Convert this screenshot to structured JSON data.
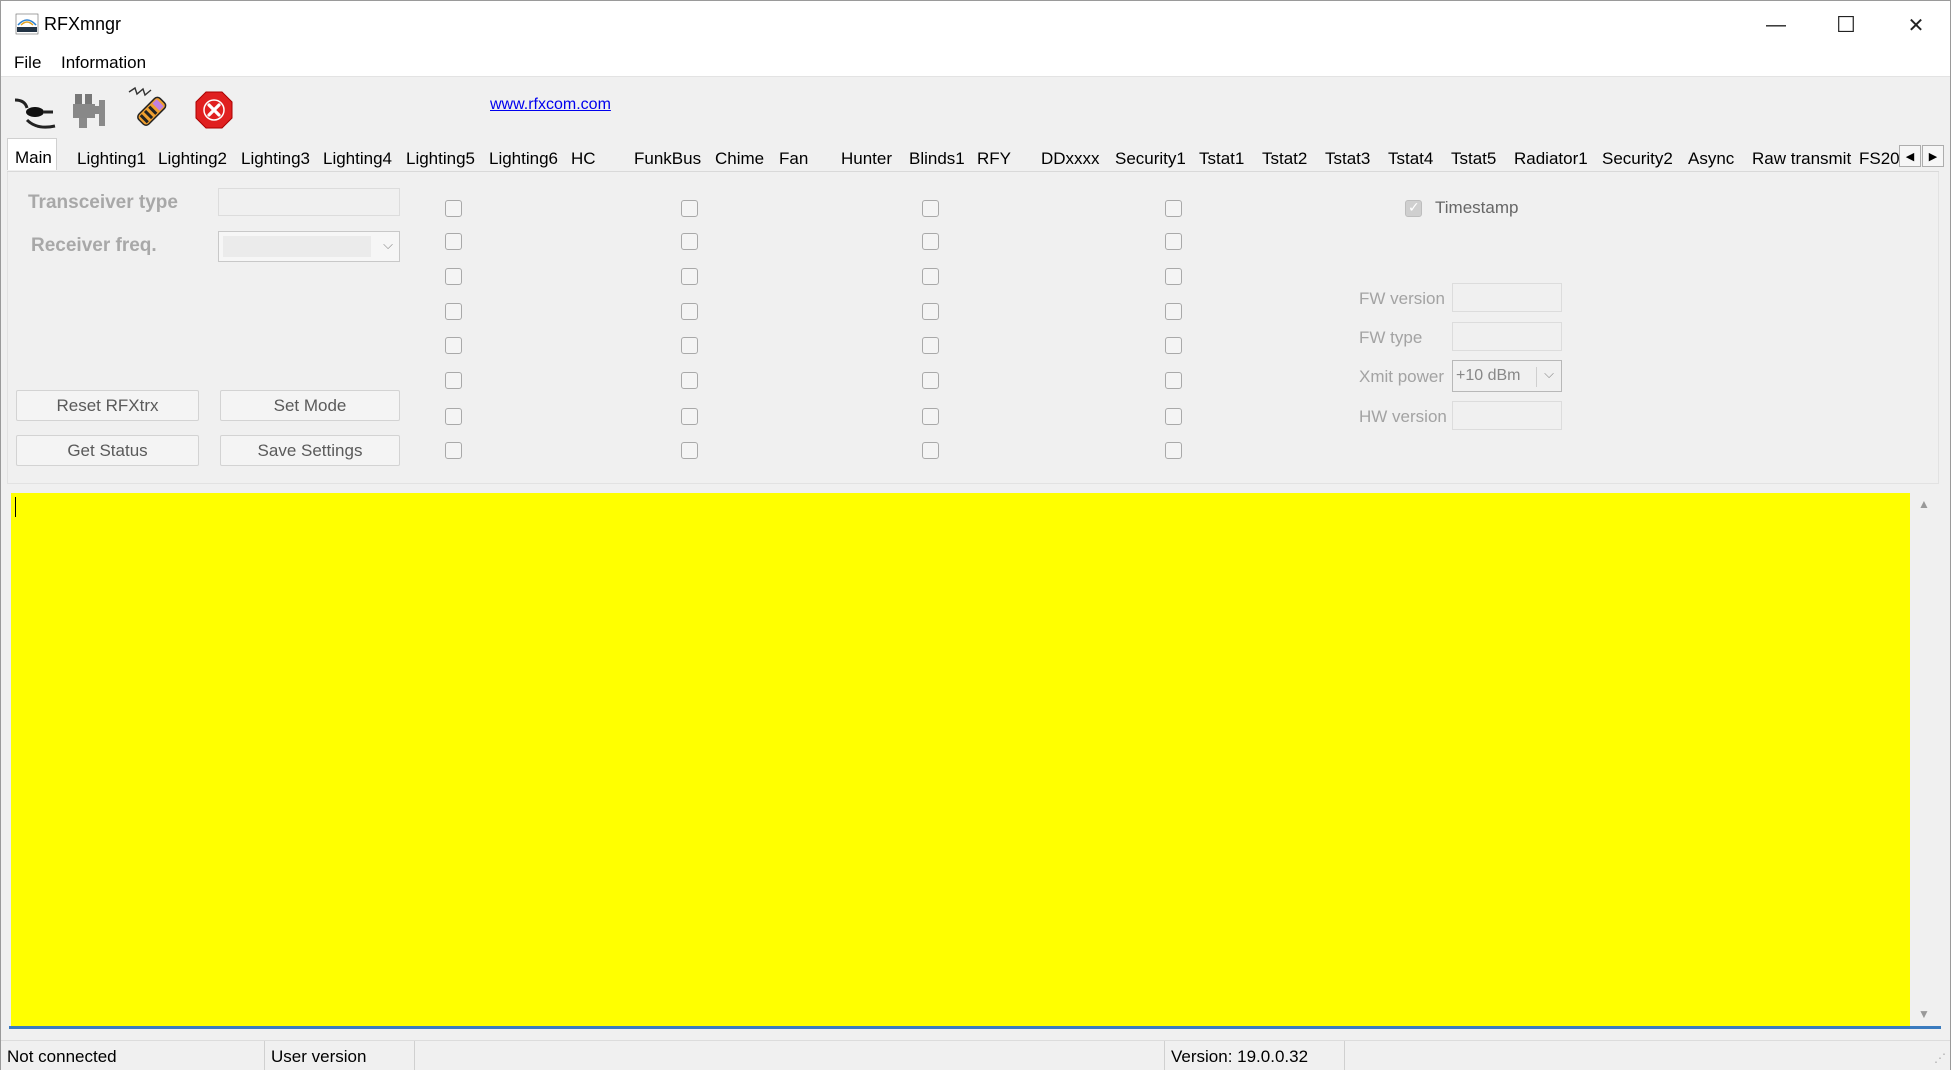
{
  "window": {
    "title": "RFXmngr",
    "minimize_glyph": "—",
    "maximize_glyph": "☐",
    "close_glyph": "✕"
  },
  "menu": {
    "items": [
      "File",
      "Information"
    ]
  },
  "toolbar": {
    "icons": [
      "connect-cable-icon",
      "disconnect-plug-icon",
      "transmitter-icon",
      "stop-icon"
    ],
    "link": "www.rfxcom.com"
  },
  "tabs": {
    "items": [
      "Main",
      "Lighting1",
      "Lighting2",
      "Lighting3",
      "Lighting4",
      "Lighting5",
      "Lighting6",
      "HC",
      "FunkBus",
      "Chime",
      "Fan",
      "Hunter",
      "Blinds1",
      "RFY",
      "DDxxxx",
      "Security1",
      "Tstat1",
      "Tstat2",
      "Tstat3",
      "Tstat4",
      "Tstat5",
      "Radiator1",
      "Security2",
      "Async",
      "Raw transmit",
      "FS20"
    ],
    "active": "Main",
    "scroll_left": "◀",
    "scroll_right": "▶"
  },
  "main": {
    "transceiver_type_label": "Transceiver type",
    "transceiver_type_value": "",
    "receiver_freq_label": "Receiver freq.",
    "receiver_freq_value": "",
    "buttons": {
      "reset": "Reset RFXtrx",
      "set_mode": "Set Mode",
      "get_status": "Get Status",
      "save_settings": "Save Settings"
    },
    "checkbox_columns": 4,
    "checkbox_rows": 8,
    "timestamp_label": "Timestamp",
    "timestamp_checked": true,
    "fw_version_label": "FW version",
    "fw_version_value": "",
    "fw_type_label": "FW type",
    "fw_type_value": "",
    "xmit_power_label": "Xmit power",
    "xmit_power_value": "+10 dBm",
    "hw_version_label": "HW version",
    "hw_version_value": ""
  },
  "log": {
    "background": "#ffff00",
    "text": ""
  },
  "status_bar": {
    "connection": "Not connected",
    "user": "User version",
    "version": "Version: 19.0.0.32"
  },
  "colors": {
    "link": "#0000ee",
    "log_bg": "#ffff00",
    "log_border": "#3a7bbf"
  }
}
